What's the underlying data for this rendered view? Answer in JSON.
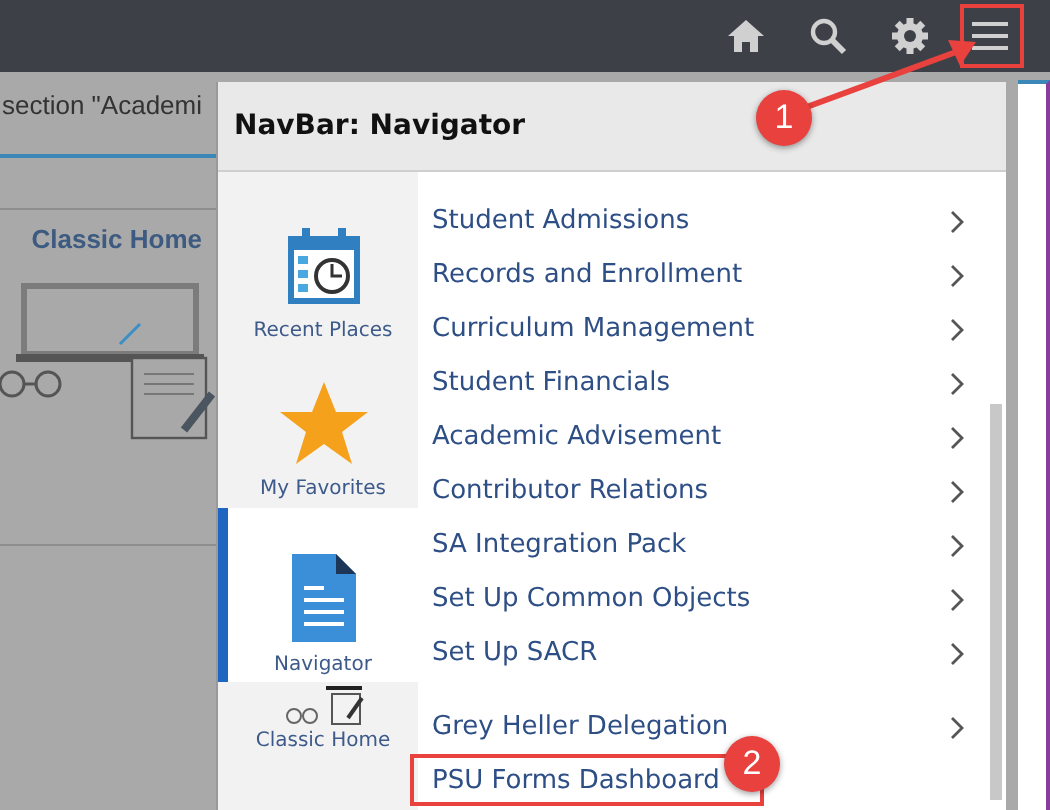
{
  "header_icons": [
    {
      "kind": "home",
      "highlighted": false
    },
    {
      "kind": "search",
      "highlighted": false
    },
    {
      "kind": "settings",
      "highlighted": false
    },
    {
      "kind": "menu",
      "highlighted": true
    }
  ],
  "background": {
    "breadcrumb": "section \"Academi",
    "tile": {
      "title": "Classic Home"
    }
  },
  "panel": {
    "title": "NavBar: Navigator",
    "sidebar": [
      {
        "label": "Recent Places",
        "kind": "calendar",
        "selected": false
      },
      {
        "label": "My Favorites",
        "kind": "star",
        "selected": false
      },
      {
        "label": "Navigator",
        "kind": "document",
        "selected": true
      },
      {
        "label": "Classic Home",
        "kind": "classic",
        "selected": false
      }
    ],
    "items": [
      {
        "label": "Student Admissions",
        "submenu": true,
        "gap_before": false,
        "highlighted": false
      },
      {
        "label": "Records and Enrollment",
        "submenu": true,
        "gap_before": false,
        "highlighted": false
      },
      {
        "label": "Curriculum Management",
        "submenu": true,
        "gap_before": false,
        "highlighted": false
      },
      {
        "label": "Student Financials",
        "submenu": true,
        "gap_before": false,
        "highlighted": false
      },
      {
        "label": "Academic Advisement",
        "submenu": true,
        "gap_before": false,
        "highlighted": false
      },
      {
        "label": "Contributor Relations",
        "submenu": true,
        "gap_before": false,
        "highlighted": false
      },
      {
        "label": "SA Integration Pack",
        "submenu": true,
        "gap_before": false,
        "highlighted": false
      },
      {
        "label": "Set Up Common Objects",
        "submenu": true,
        "gap_before": false,
        "highlighted": false
      },
      {
        "label": "Set Up SACR",
        "submenu": true,
        "gap_before": false,
        "highlighted": false
      },
      {
        "label": "Grey Heller Delegation",
        "submenu": true,
        "gap_before": true,
        "highlighted": false
      },
      {
        "label": "PSU Forms Dashboard",
        "submenu": false,
        "gap_before": false,
        "highlighted": true
      }
    ]
  },
  "callouts": [
    {
      "number": "1",
      "kind": "arrow"
    },
    {
      "number": "2",
      "kind": "plain"
    }
  ]
}
